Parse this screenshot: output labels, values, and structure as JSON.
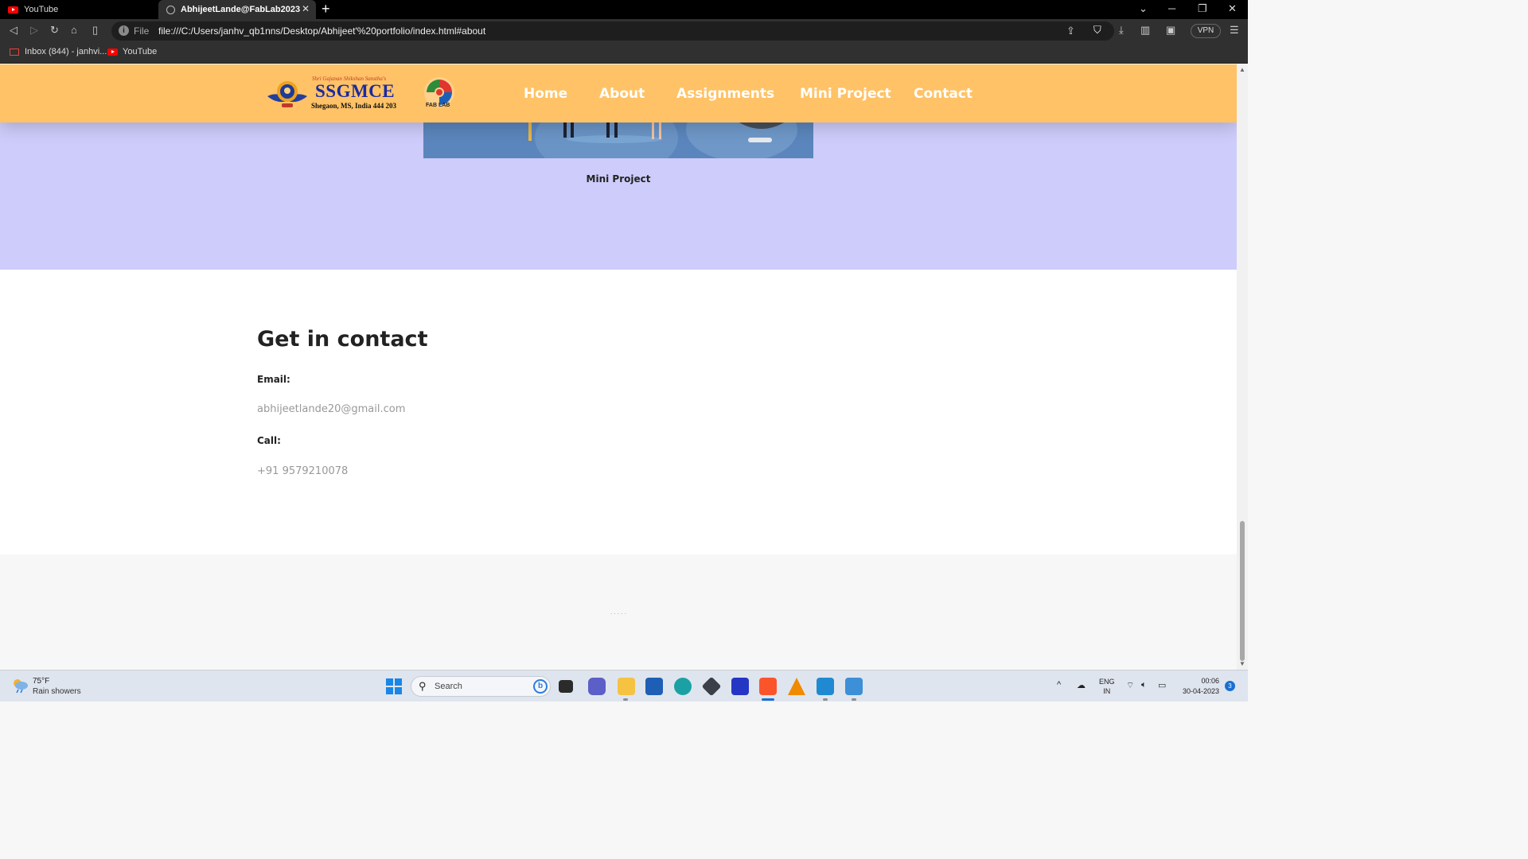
{
  "browser": {
    "tabs": [
      {
        "title": "YouTube",
        "active": false,
        "icon": "youtube-icon"
      },
      {
        "title": "AbhijeetLande@FabLab2023",
        "active": true,
        "icon": "globe-icon"
      }
    ],
    "address_prefix": "File",
    "url": "file:///C:/Users/janhv_qb1nns/Desktop/Abhijeet'%20portfolio/index.html#about",
    "vpn_label": "VPN",
    "bookmarks": [
      {
        "label": "Inbox (844) - janhvi...",
        "icon": "gmail-icon"
      },
      {
        "label": "YouTube",
        "icon": "youtube-icon"
      }
    ]
  },
  "site": {
    "logo": {
      "small_text": "Shri Gajanan Shikshan Sanstha's",
      "name": "SSGMCE",
      "address": "Shegaon, MS, India 444 203",
      "fablab_text": "FAB LAB"
    },
    "nav": [
      "Home",
      "About",
      "Assignments",
      "Mini Project",
      "Contact"
    ],
    "mini_project_caption": "Mini Project",
    "contact": {
      "heading": "Get in contact",
      "email_label": "Email:",
      "email_value": "abhijeetlande20@gmail.com",
      "call_label": "Call:",
      "call_value": "+91 9579210078"
    },
    "footer_text": ". . . . ."
  },
  "taskbar": {
    "weather_temp": "75°F",
    "weather_desc": "Rain showers",
    "search_placeholder": "Search",
    "lang_line1": "ENG",
    "lang_line2": "IN",
    "time": "00:06",
    "date": "30-04-2023",
    "notification_count": "3"
  },
  "colors": {
    "navbar": "#ffc266",
    "purple_section": "#cdccfa",
    "accent_blue": "#1a6fd1"
  }
}
